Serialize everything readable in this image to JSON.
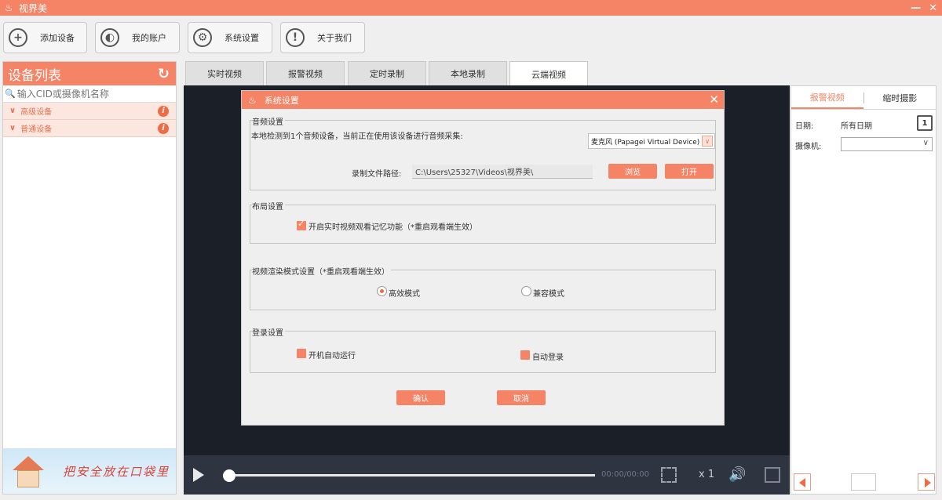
{
  "app": {
    "title": "视界美",
    "window_buttons": [
      "—",
      "✕"
    ]
  },
  "toolbar": {
    "add_device": "添加设备",
    "my_account": "我的账户",
    "settings": "系统设置",
    "about": "关于我们"
  },
  "device_list": {
    "title": "设备列表",
    "search_placeholder": "输入CID或摄像机名称",
    "groups": [
      "高级设备",
      "普通设备"
    ],
    "banner_slogan": "把安全放在口袋里"
  },
  "tabs": [
    "实时视频",
    "报警视频",
    "定时录制",
    "本地录制",
    "云端视频"
  ],
  "player": {
    "timecode": "00:00/00:00",
    "speed": "x 1",
    "progress": 0
  },
  "right_panel": {
    "tabs": [
      "报警视频",
      "缩时摄影"
    ],
    "date_label": "日期:",
    "date_value": "所有日期",
    "calendar_day": "1",
    "camera_label": "摄像机:",
    "camera_value": ""
  },
  "dialog": {
    "title": "系统设置",
    "audio": {
      "legend": "音频设置",
      "note": "本地检测到1个音频设备，当前正在使用该设备进行音频采集:",
      "mic": "麦克风 (Papagei Virtual Device)",
      "path_label": "录制文件路径:",
      "path_value": "C:\\Users\\25327\\Videos\\视界美\\",
      "browse": "浏览",
      "open": "打开"
    },
    "layout": {
      "legend": "布局设置",
      "remember_label": "开启实时视频观看记忆功能（*重启观看端生效）",
      "remember_checked": true
    },
    "render": {
      "legend": "视频渲染模式设置（*重启观看端生效）",
      "options": [
        "高效模式",
        "兼容模式"
      ],
      "selected": "高效模式"
    },
    "login": {
      "legend": "登录设置",
      "autostart": "开机自动运行",
      "autologin": "自动登录"
    },
    "ok": "确认",
    "cancel": "取消"
  },
  "colors": {
    "accent": "#f58466",
    "accent_dark": "#f06b43",
    "video_bg": "#1b1f27",
    "control_bg": "#2e3440"
  }
}
